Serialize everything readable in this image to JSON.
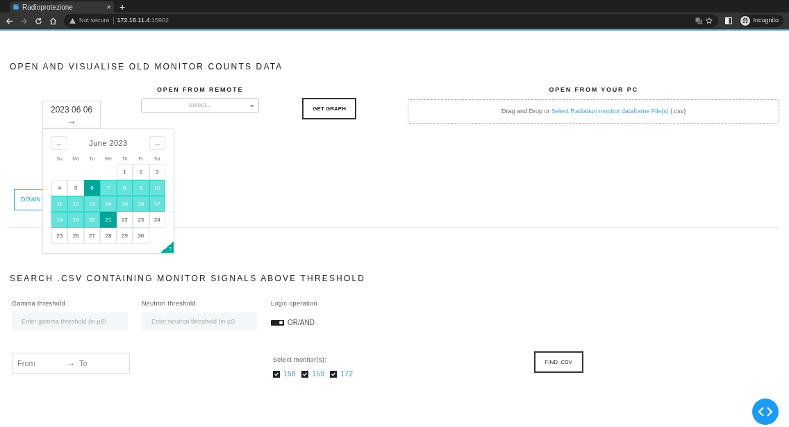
{
  "browser": {
    "tab_title": "Radioprotezione",
    "tab_close": "×",
    "new_tab": "+",
    "security": "Not secure",
    "url_host": "172.16.11.4",
    "url_port": ":15902",
    "profile": "Incognito"
  },
  "open_section": {
    "title": "OPEN AND VISUALISE OLD MONITOR COUNTS DATA",
    "date_picker": {
      "value": "2023 06 06",
      "arrow": "→"
    },
    "remote": {
      "label": "OPEN FROM REMOTE",
      "placeholder": "Select..."
    },
    "get_graph": "GET GRAPH",
    "pc": {
      "label": "OPEN FROM YOUR PC",
      "prefix": "Drag and Drop or ",
      "link": "Select Radiation monitor dataframe File(s)",
      "suffix": " (.csv)"
    },
    "download": "DOWN"
  },
  "calendar": {
    "prev": "←",
    "next": "→",
    "month": "June 2023",
    "weekdays": [
      "Su",
      "Mo",
      "Tu",
      "We",
      "Th",
      "Fr",
      "Sa"
    ],
    "help": "?",
    "weeks": [
      [
        {
          "day": "1",
          "selected": false,
          "in_range": false
        },
        {
          "day": "2",
          "selected": false,
          "in_range": false
        },
        {
          "day": "3",
          "selected": false,
          "in_range": false
        }
      ],
      [
        {
          "day": "4",
          "selected": false,
          "in_range": false
        },
        {
          "day": "5",
          "selected": false,
          "in_range": false
        },
        {
          "day": "6",
          "selected": true,
          "in_range": false
        },
        {
          "day": "7",
          "selected": false,
          "in_range": true
        },
        {
          "day": "8",
          "selected": false,
          "in_range": true
        },
        {
          "day": "9",
          "selected": false,
          "in_range": true
        },
        {
          "day": "10",
          "selected": false,
          "in_range": true
        }
      ],
      [
        {
          "day": "11",
          "selected": false,
          "in_range": true
        },
        {
          "day": "12",
          "selected": false,
          "in_range": true
        },
        {
          "day": "13",
          "selected": false,
          "in_range": true
        },
        {
          "day": "14",
          "selected": false,
          "in_range": true
        },
        {
          "day": "15",
          "selected": false,
          "in_range": true
        },
        {
          "day": "16",
          "selected": false,
          "in_range": true
        },
        {
          "day": "17",
          "selected": false,
          "in_range": true
        }
      ],
      [
        {
          "day": "18",
          "selected": false,
          "in_range": true
        },
        {
          "day": "19",
          "selected": false,
          "in_range": true
        },
        {
          "day": "20",
          "selected": false,
          "in_range": true
        },
        {
          "day": "21",
          "selected": true,
          "in_range": false
        },
        {
          "day": "22",
          "selected": false,
          "in_range": false
        },
        {
          "day": "23",
          "selected": false,
          "in_range": false
        },
        {
          "day": "24",
          "selected": false,
          "in_range": false
        }
      ],
      [
        {
          "day": "25",
          "selected": false,
          "in_range": false
        },
        {
          "day": "26",
          "selected": false,
          "in_range": false
        },
        {
          "day": "27",
          "selected": false,
          "in_range": false
        },
        {
          "day": "28",
          "selected": false,
          "in_range": false
        },
        {
          "day": "29",
          "selected": false,
          "in_range": false
        },
        {
          "day": "30",
          "selected": false,
          "in_range": false
        }
      ]
    ]
  },
  "search_section": {
    "title": "SEARCH .CSV CONTAINING MONITOR SIGNALS ABOVE THRESHOLD",
    "gamma": {
      "label": "Gamma threshold",
      "placeholder": "Enter gamma threshold (in µS\\"
    },
    "neutron": {
      "label": "Neutron threshold",
      "placeholder": "Enter neutron threshold (in µS"
    },
    "logic": {
      "label": "Logic operation",
      "on": true,
      "text": "OR/AND"
    },
    "range": {
      "from": "From",
      "arrow": "→",
      "to": "To"
    },
    "monitors_label": "Select monitor(s):",
    "monitors": [
      {
        "label": "158",
        "checked": true
      },
      {
        "label": "159",
        "checked": true
      },
      {
        "label": "172",
        "checked": true
      }
    ],
    "find": "FIND .CSV"
  }
}
